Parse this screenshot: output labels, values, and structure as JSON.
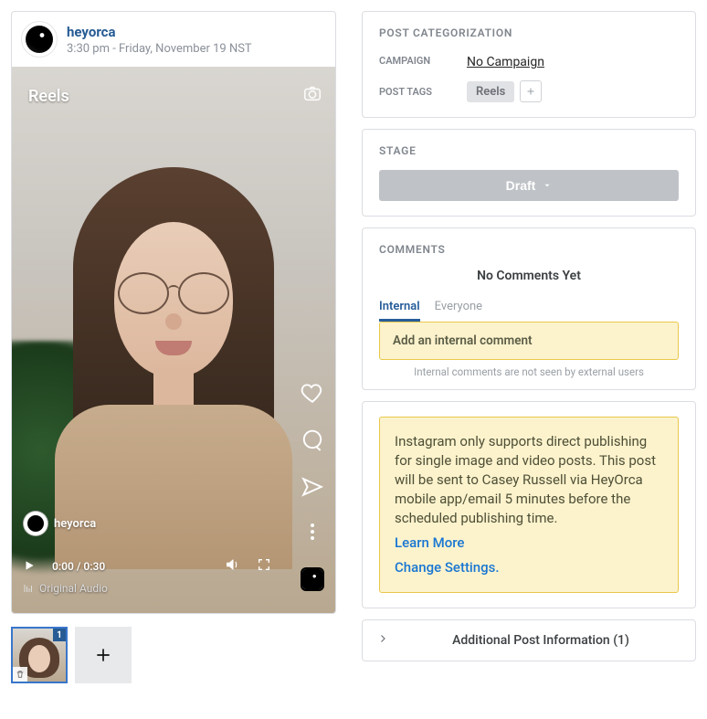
{
  "post": {
    "handle": "heyorca",
    "timestamp": "3:30 pm - Friday, November 19 NST",
    "reel_label": "Reels",
    "handle_overlay": "heyorca",
    "playback_time": "0:00 / 0:30",
    "audio_label": "Original Audio",
    "thumb_badge": "1"
  },
  "categorization": {
    "title": "POST CATEGORIZATION",
    "campaign_label": "CAMPAIGN",
    "campaign_value": "No Campaign",
    "tags_label": "POST TAGS",
    "tags": [
      "Reels"
    ]
  },
  "stage": {
    "title": "STAGE",
    "value": "Draft"
  },
  "comments": {
    "title": "COMMENTS",
    "empty": "No Comments Yet",
    "tab_internal": "Internal",
    "tab_everyone": "Everyone",
    "placeholder": "Add an internal comment",
    "hint": "Internal comments are not seen by external users"
  },
  "notice": {
    "body": "Instagram only supports direct publishing for single image and video posts. This post will be sent to Casey Russell via HeyOrca mobile app/email 5 minutes before the scheduled publishing time.",
    "learn_more": "Learn More",
    "change_settings": "Change Settings."
  },
  "accordion": {
    "title": "Additional Post Information (1)"
  }
}
